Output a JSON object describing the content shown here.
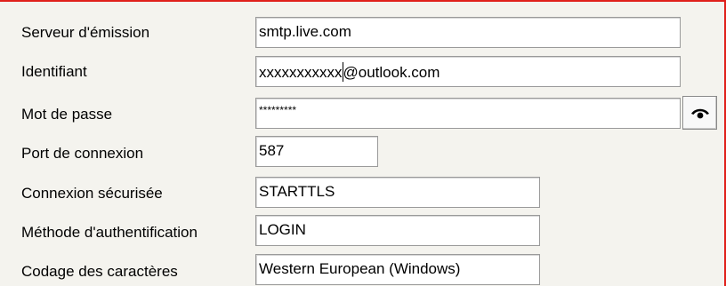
{
  "form": {
    "server": {
      "label": "Serveur d'émission",
      "value": "smtp.live.com"
    },
    "identifier": {
      "label": "Identifiant",
      "value_before_caret": "xxxxxxxxxxx",
      "value_after_caret": "@outlook.com"
    },
    "password": {
      "label": "Mot de passe",
      "value": "*********",
      "toggle_icon": "eye-icon"
    },
    "port": {
      "label": "Port de connexion",
      "value": "587"
    },
    "secure": {
      "label": "Connexion sécurisée",
      "value": "STARTTLS"
    },
    "auth": {
      "label": "Méthode d'authentification",
      "value": "LOGIN"
    },
    "encoding": {
      "label": "Codage des caractères",
      "value": "Western European (Windows)"
    }
  },
  "colors": {
    "panel_background": "#f4f3ee",
    "border_accent": "#e0201b",
    "field_background": "#ffffff",
    "field_border": "#9a9a9a"
  }
}
